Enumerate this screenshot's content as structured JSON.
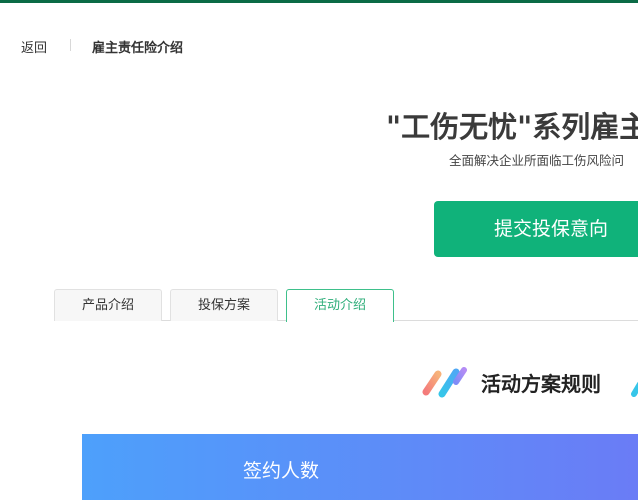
{
  "nav": {
    "back_label": "返回",
    "title": "雇主责任险介绍"
  },
  "hero": {
    "title": "\"工伤无忧\"系列雇主",
    "subtitle": "全面解决企业所面临工伤风险问",
    "cta_label": "提交投保意向"
  },
  "tabs": [
    {
      "label": "产品介绍",
      "active": false
    },
    {
      "label": "投保方案",
      "active": false
    },
    {
      "label": "活动介绍",
      "active": true
    }
  ],
  "section": {
    "title": "活动方案规则"
  },
  "banner": {
    "label": "签约人数"
  },
  "colors": {
    "top_line": "#0b6b46",
    "accent_green": "#10b27a",
    "active_tab": "#2fae7a",
    "banner_start": "#4da0fb",
    "banner_end": "#6a7cf6"
  },
  "icons": {
    "section_decoration": "slanted-stripes-icon"
  }
}
